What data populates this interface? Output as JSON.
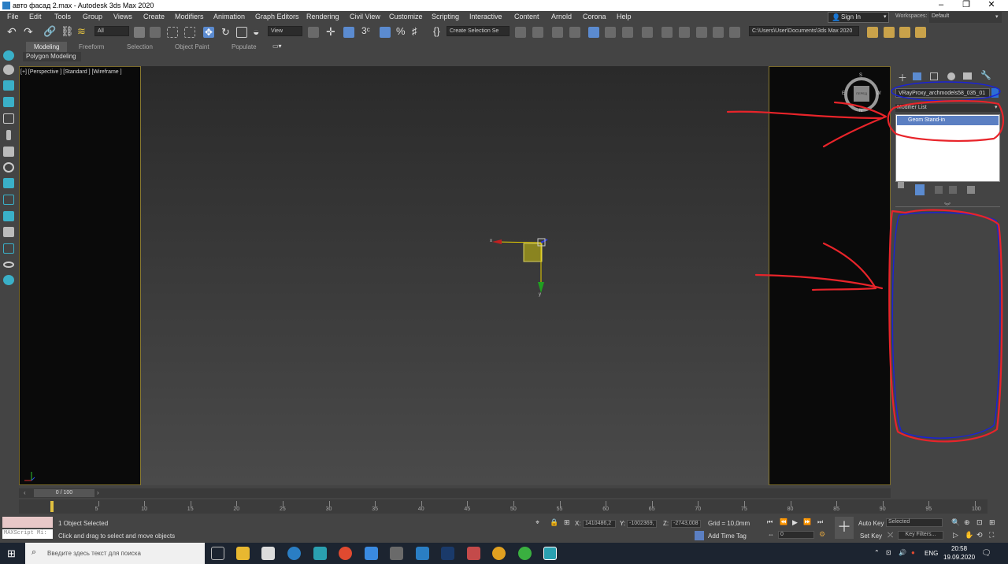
{
  "window": {
    "title": "авто фасад 2.max - Autodesk 3ds Max 2020"
  },
  "menu": [
    "File",
    "Edit",
    "Tools",
    "Group",
    "Views",
    "Create",
    "Modifiers",
    "Animation",
    "Graph Editors",
    "Rendering",
    "Civil View",
    "Customize",
    "Scripting",
    "Interactive",
    "Content",
    "Arnold",
    "Corona",
    "Help"
  ],
  "account": {
    "signin": "Sign In",
    "workspaces_label": "Workspaces:",
    "workspace": "Default"
  },
  "toolbar": {
    "filter": "All",
    "refcoord": "View",
    "selset": "Create Selection Se",
    "path": "C:\\Users\\User\\Documents\\3ds Max 2020"
  },
  "ribbon": {
    "tabs": [
      "Modeling",
      "Freeform",
      "Selection",
      "Object Paint",
      "Populate"
    ],
    "subtab": "Polygon Modeling"
  },
  "viewport": {
    "label": "[+] [Perspective ] [Standard ] [Wireframe ]",
    "viewcube": "ПЕРЕД",
    "compass_n": "N",
    "compass_s": "S",
    "compass_w": "W",
    "compass_e": "E"
  },
  "command_panel": {
    "object_name": "VRayProxy_archmodels58_035_01",
    "modifier_list": "Modifier List",
    "stack_item": "Geom Stand-in",
    "object_color": "#2c6fd6"
  },
  "timeline": {
    "frame": "0 / 100",
    "ticks": [
      "5",
      "10",
      "15",
      "20",
      "25",
      "30",
      "35",
      "40",
      "45",
      "50",
      "55",
      "60",
      "65",
      "70",
      "75",
      "80",
      "85",
      "90",
      "95",
      "100"
    ]
  },
  "status": {
    "selected": "1 Object Selected",
    "hint": "Click and drag to select and move objects",
    "maxscript": "MAXScript Mi:",
    "x_label": "X:",
    "x": "1410486,2",
    "y_label": "Y:",
    "y": "-1002369,",
    "z_label": "Z:",
    "z": "-2743,008",
    "grid": "Grid = 10,0mm",
    "add_time_tag": "Add Time Tag",
    "auto_key": "Auto Key",
    "set_key": "Set Key",
    "selected_mode": "Selected",
    "key_filters": "Key Filters...",
    "frame_field": "0"
  },
  "taskbar": {
    "search_placeholder": "Введите здесь текст для поиска",
    "lang": "ENG",
    "time": "20:58",
    "date": "19.09.2020"
  },
  "gizmo": {
    "x": "x",
    "y": "y"
  }
}
